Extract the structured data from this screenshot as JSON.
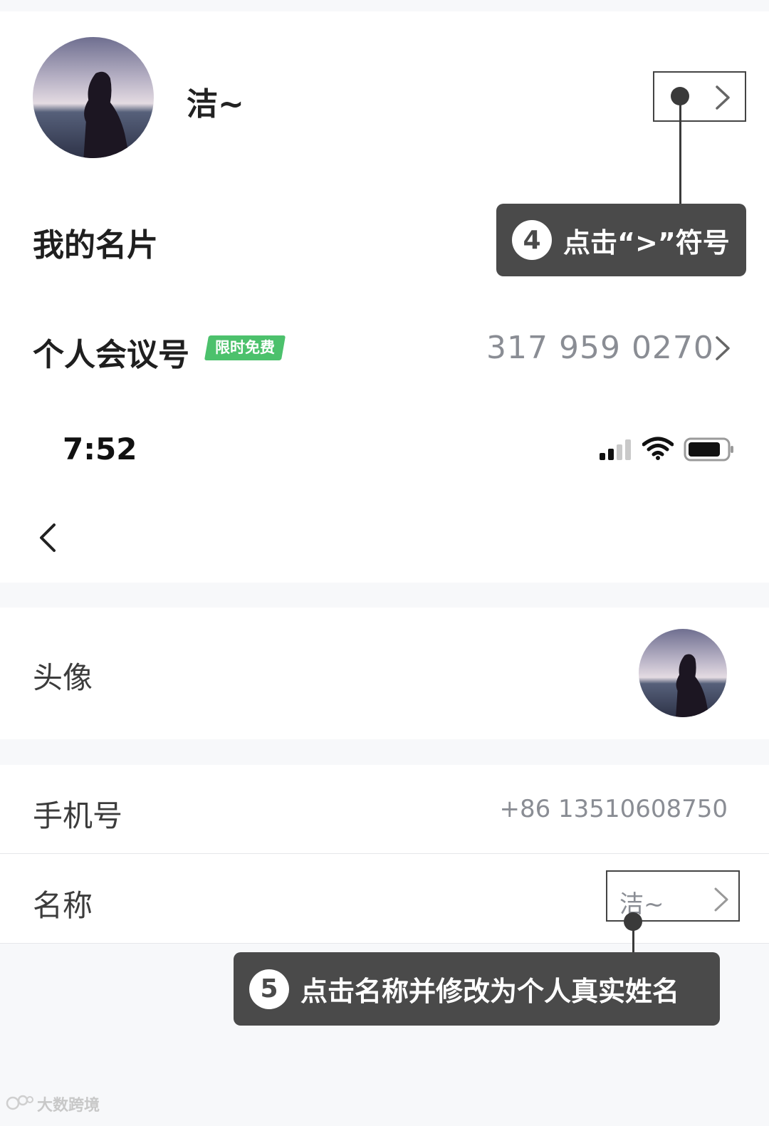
{
  "profile": {
    "name": "洁~",
    "my_card_label": "我的名片",
    "meeting_label": "个人会议号",
    "meeting_badge": "限时免费",
    "meeting_number": "317 959 0270"
  },
  "callout_4": {
    "number": "4",
    "text": "点击“>”符号"
  },
  "status_bar": {
    "time": "7:52"
  },
  "settings": {
    "avatar_label": "头像",
    "phone_label": "手机号",
    "phone_value": "+86 13510608750",
    "name_label": "名称",
    "name_value": "洁~"
  },
  "callout_5": {
    "number": "5",
    "text": "点击名称并修改为个人真实姓名"
  },
  "watermark": "大数跨境",
  "colors": {
    "badge_green": "#4cc16c",
    "callout_bg": "#4a4a4a",
    "secondary_text": "#8a8d94"
  }
}
